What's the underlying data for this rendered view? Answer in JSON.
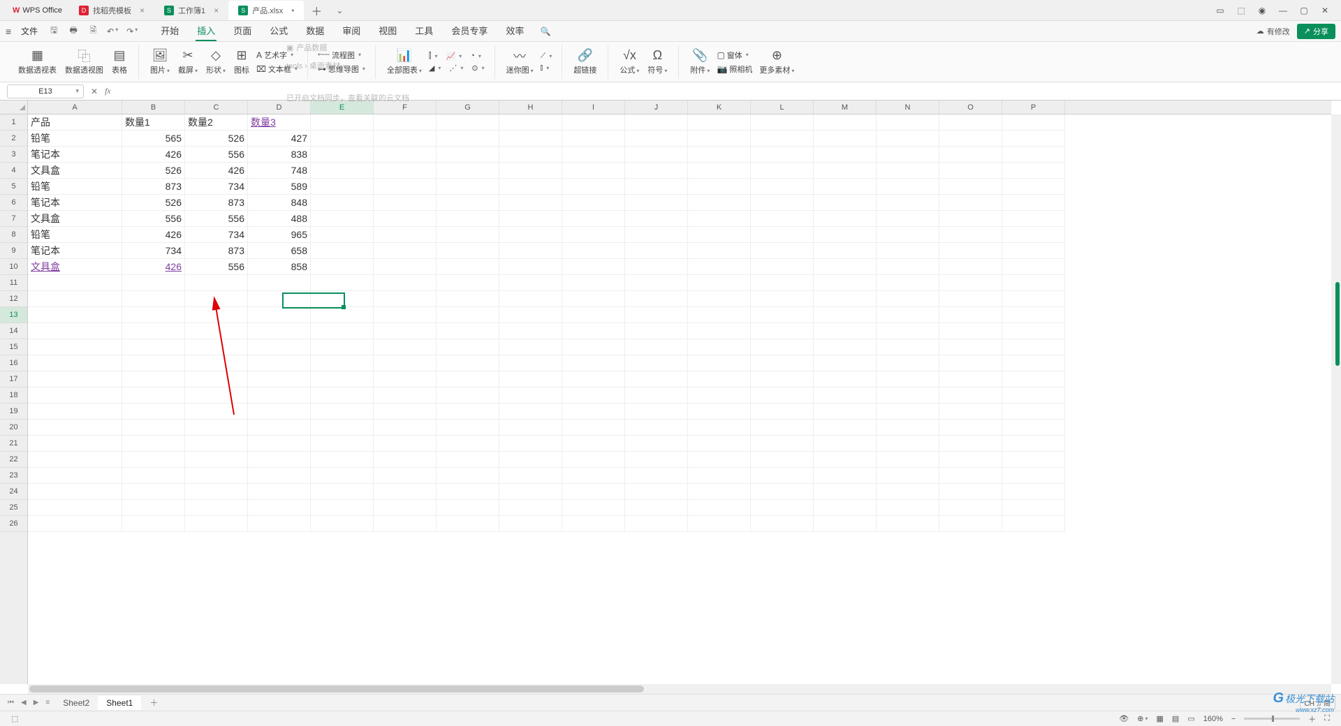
{
  "app_name": "WPS Office",
  "tabs": [
    {
      "icon_color": "#d23",
      "icon_text": "D",
      "label": "找稻壳模板"
    },
    {
      "icon_color": "#0a8f5b",
      "icon_text": "S",
      "label": "工作簿1"
    },
    {
      "icon_color": "#0a8f5b",
      "icon_text": "S",
      "label": "产品.xlsx",
      "active": true
    }
  ],
  "file_menu": "文件",
  "menu_tabs": [
    "开始",
    "插入",
    "页面",
    "公式",
    "数据",
    "审阅",
    "视图",
    "工具",
    "会员专享",
    "效率"
  ],
  "menu_active_index": 1,
  "cloud_sync": "有修改",
  "share_label": "分享",
  "ribbon": {
    "pivot_table": "数据透视表",
    "pivot_chart": "数据透视图",
    "table": "表格",
    "image": "图片",
    "screenshot": "截屏",
    "shape": "形状",
    "icon": "图标",
    "wordart": "艺术字",
    "textbox": "文本框",
    "flowchart": "流程图",
    "mindmap": "思维导图",
    "allcharts": "全部图表",
    "sparkline": "迷你图",
    "hyperlink": "超链接",
    "formula": "公式",
    "symbol": "符号",
    "attach": "附件",
    "camera": "照相机",
    "more": "更多素材",
    "form": "窗体"
  },
  "overlay": {
    "crumb1": "产品数据",
    "crumb2": "tools › 桌面素材 › ...",
    "sync_text": "已开启文档同步，查看关联的云文档"
  },
  "namebox": "E13",
  "columns": [
    "A",
    "B",
    "C",
    "D",
    "E",
    "F",
    "G",
    "H",
    "I",
    "J",
    "K",
    "L",
    "M",
    "N",
    "O",
    "P"
  ],
  "selected_col": "E",
  "row_count": 26,
  "selected_row": 13,
  "data": {
    "headers": [
      "产品",
      "数量1",
      "数量2",
      "数量3"
    ],
    "header_link_index": 3,
    "rows": [
      [
        "铅笔",
        "565",
        "526",
        "427"
      ],
      [
        "笔记本",
        "426",
        "556",
        "838"
      ],
      [
        "文具盒",
        "526",
        "426",
        "748"
      ],
      [
        "铅笔",
        "873",
        "734",
        "589"
      ],
      [
        "笔记本",
        "526",
        "873",
        "848"
      ],
      [
        "文具盒",
        "556",
        "556",
        "488"
      ],
      [
        "铅笔",
        "426",
        "734",
        "965"
      ],
      [
        "笔记本",
        "734",
        "873",
        "658"
      ],
      [
        "文具盒",
        "426",
        "556",
        "858"
      ]
    ],
    "last_row_link_cells": [
      0,
      1
    ]
  },
  "sheets": [
    "Sheet2",
    "Sheet1"
  ],
  "active_sheet": 1,
  "ime": "CH ♫ 简",
  "zoom": "160%",
  "watermark": {
    "brand": "极光下载站",
    "url": "www.xz7.com"
  }
}
